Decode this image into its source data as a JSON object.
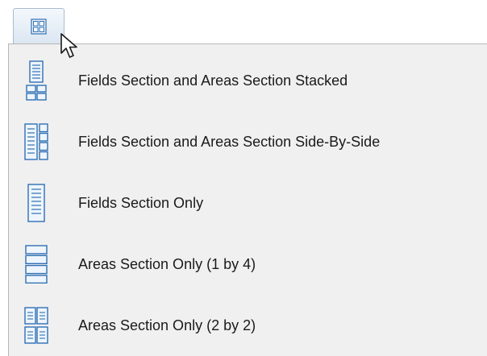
{
  "toolbar": {
    "layout_button_icon": "layout-grid-icon"
  },
  "menu": {
    "items": [
      {
        "label": "Fields Section and Areas Section Stacked",
        "icon": "stacked-layout-icon"
      },
      {
        "label": "Fields Section and Areas Section Side-By-Side",
        "icon": "side-by-side-layout-icon"
      },
      {
        "label": "Fields Section Only",
        "icon": "fields-only-layout-icon"
      },
      {
        "label": "Areas Section Only (1 by 4)",
        "icon": "areas-1by4-layout-icon"
      },
      {
        "label": "Areas Section Only (2 by 2)",
        "icon": "areas-2by2-layout-icon"
      }
    ]
  },
  "colors": {
    "icon_fill": "#eef5fd",
    "icon_stroke": "#2f6fb3",
    "menu_background": "#f0f0f0",
    "text": "#1a1a1a"
  }
}
